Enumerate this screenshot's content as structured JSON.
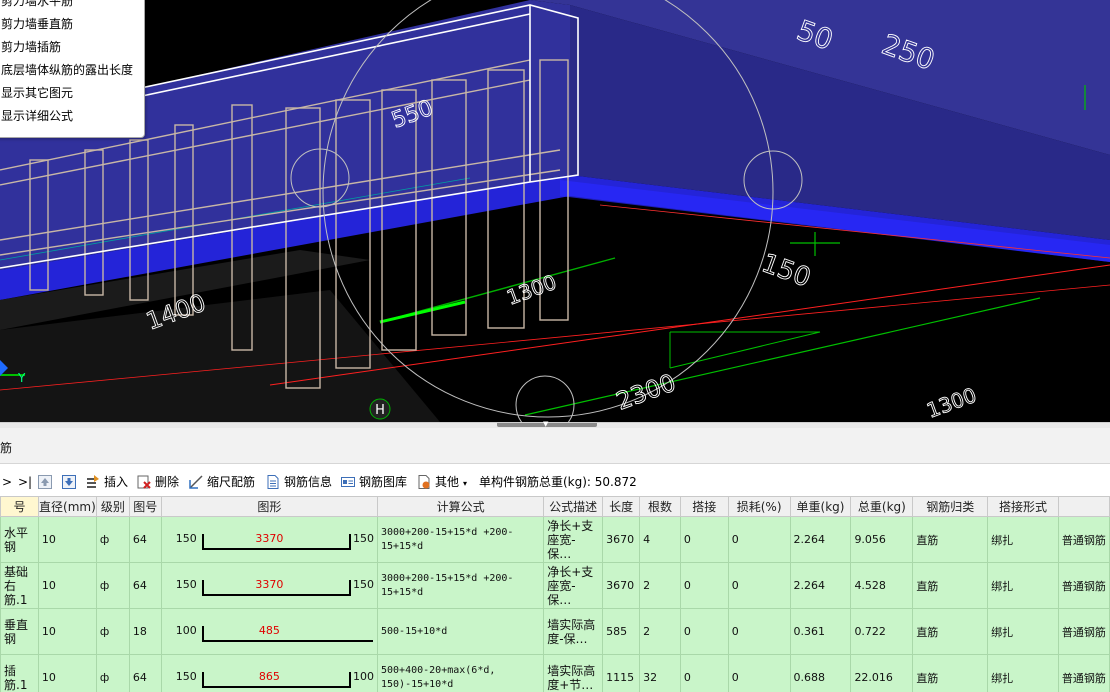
{
  "viewport": {
    "menu_items": [
      "剪力墙水平筋",
      "剪力墙垂直筋",
      "剪力墙插筋",
      "底层墙体纵筋的露出长度",
      "显示其它图元",
      "显示详细公式"
    ],
    "dim_labels": [
      "50",
      "250",
      "550",
      "1400",
      "1300",
      "2300",
      "1300",
      "150"
    ],
    "axis_label": "H",
    "y_axis": "Y",
    "colors": {
      "wall_blue": "#3f3fb0",
      "rebar": "#c8b7a6",
      "green": "#00c000",
      "red": "#ff2020"
    }
  },
  "panel": {
    "title": "筋"
  },
  "toolbar": {
    "nav_prev": ">",
    "nav_last": ">|",
    "insert": "插入",
    "delete": "删除",
    "scale": "缩尺配筋",
    "info": "钢筋信息",
    "library": "钢筋图库",
    "other": "其他",
    "total_label": "单构件钢筋总重(kg): 50.872"
  },
  "grid": {
    "headers": [
      "号",
      "直径(mm)",
      "级别",
      "图号",
      "图形",
      "计算公式",
      "公式描述",
      "长度",
      "根数",
      "搭接",
      "损耗(%)",
      "单重(kg)",
      "总重(kg)",
      "钢筋归类",
      "搭接形式",
      ""
    ],
    "rows": [
      {
        "name": "水平钢",
        "dia": "10",
        "grade": "ф",
        "fig": "64",
        "left": "150",
        "mid": "3370",
        "right": "150",
        "formula": "3000+200-15+15*d +200-15+15*d",
        "desc": "净长+支座宽-保…",
        "len": "3670",
        "count": "4",
        "lap": "0",
        "loss": "0",
        "unit": "2.264",
        "total": "9.056",
        "cls": "直筋",
        "lapType": "绑扎",
        "kind": "普通钢筋"
      },
      {
        "name": "基础右\n筋.1",
        "dia": "10",
        "grade": "ф",
        "fig": "64",
        "left": "150",
        "mid": "3370",
        "right": "150",
        "formula": "3000+200-15+15*d +200-15+15*d",
        "desc": "净长+支座宽-保…",
        "len": "3670",
        "count": "2",
        "lap": "0",
        "loss": "0",
        "unit": "2.264",
        "total": "4.528",
        "cls": "直筋",
        "lapType": "绑扎",
        "kind": "普通钢筋"
      },
      {
        "name": "垂直钢",
        "dia": "10",
        "grade": "ф",
        "fig": "18",
        "left": "100",
        "mid": "485",
        "right": "",
        "formula": "500-15+10*d",
        "desc": "墙实际高度-保…",
        "len": "585",
        "count": "2",
        "lap": "0",
        "loss": "0",
        "unit": "0.361",
        "total": "0.722",
        "cls": "直筋",
        "lapType": "绑扎",
        "kind": "普通钢筋"
      },
      {
        "name": "插筋.1",
        "dia": "10",
        "grade": "ф",
        "fig": "64",
        "left": "150",
        "mid": "865",
        "right": "100",
        "formula": "500+400-20+max(6*d, 150)-15+10*d",
        "desc": "墙实际高度+节…",
        "len": "1115",
        "count": "32",
        "lap": "0",
        "loss": "0",
        "unit": "0.688",
        "total": "22.016",
        "cls": "直筋",
        "lapType": "绑扎",
        "kind": "普通钢筋"
      }
    ]
  }
}
